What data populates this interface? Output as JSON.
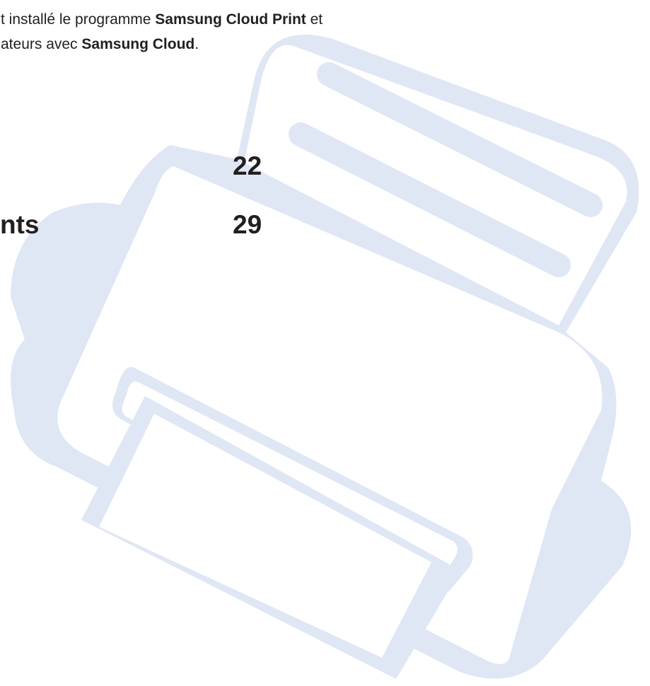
{
  "intro": {
    "line1": {
      "prefix": "t installé le programme ",
      "bold": "Samsung Cloud Print",
      "suffix": " et"
    },
    "line2": {
      "prefix": "ateurs avec ",
      "bold": "Samsung Cloud",
      "suffix": "."
    }
  },
  "toc": [
    {
      "label": "",
      "page": "22"
    },
    {
      "label": "nts",
      "page": "29"
    }
  ],
  "watermark": {
    "icon": "printer-icon",
    "color": "#dfe6f4"
  }
}
